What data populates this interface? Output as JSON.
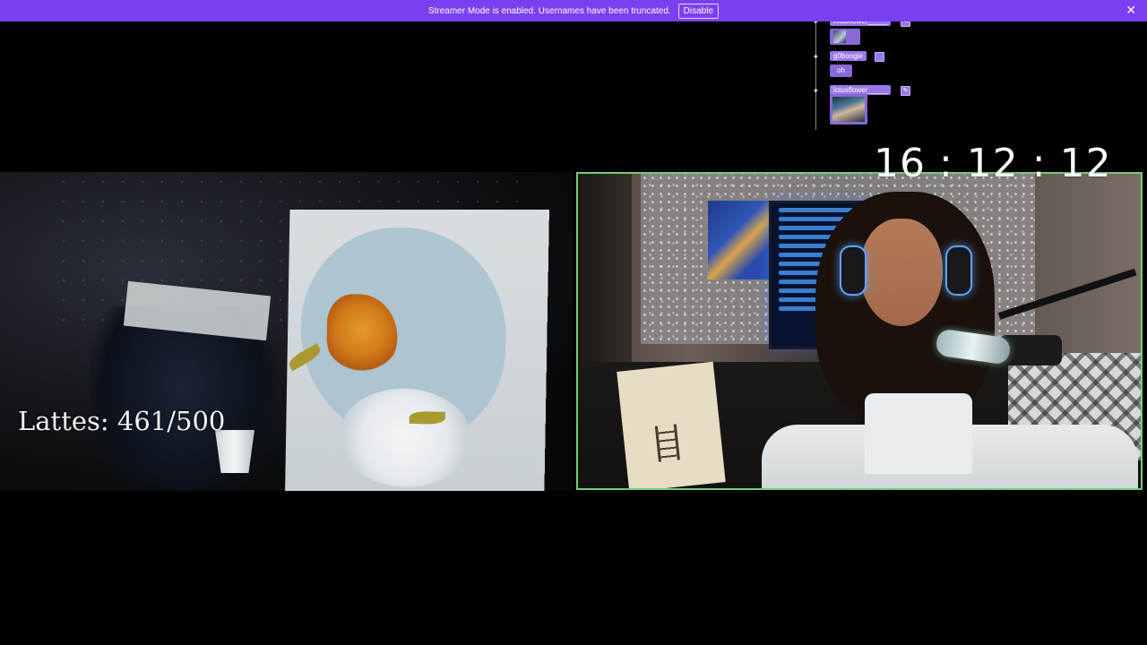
{
  "banner": {
    "message": "Streamer Mode is enabled. Usernames have been truncated.",
    "disable_label": "Disable",
    "close_glyph": "✕"
  },
  "chat": {
    "messages": [
      {
        "username": "lotusflower_____",
        "badge_icon": "pencil-icon",
        "badge_glyph": "✎",
        "content_type": "image"
      },
      {
        "username": "g0boogie",
        "badge_icon": "pencil-icon",
        "badge_glyph": "",
        "content_type": "text",
        "text": "oh"
      },
      {
        "username": "lotusflower_____",
        "badge_icon": "pencil-icon",
        "badge_glyph": "✎",
        "content_type": "image"
      }
    ],
    "dot_glyph": "✦"
  },
  "overlay": {
    "clock": "16 : 12 : 12",
    "lattes": "Lattes: 461/500"
  },
  "colors": {
    "banner_bg": "#7b3ff2",
    "chat_pill": "#9a78e8",
    "cam_border": "#6fcf7a"
  }
}
